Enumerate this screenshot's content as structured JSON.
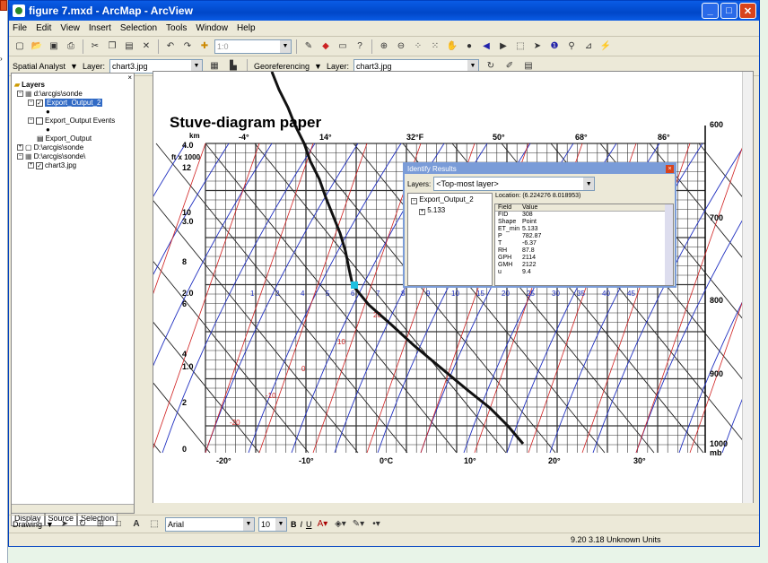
{
  "window": {
    "title": "figure 7.mxd - ArcMap - ArcView"
  },
  "menu": [
    "File",
    "Edit",
    "View",
    "Insert",
    "Selection",
    "Tools",
    "Window",
    "Help"
  ],
  "toolbar": {
    "scale_value": "1:0",
    "spatial_analyst": "Spatial Analyst",
    "layer_label": "Layer:",
    "layer_value": "chart3.jpg",
    "georef": "Georeferencing",
    "layer2_value": "chart3.jpg"
  },
  "toc": {
    "items": [
      {
        "label": "Layers",
        "indent": 0
      },
      {
        "label": "d:\\arcgis\\sonde",
        "indent": 1
      },
      {
        "label": "Export_Output_2",
        "indent": 2,
        "selected": true
      },
      {
        "label": "Export_Output Events",
        "indent": 2
      },
      {
        "label": "Export_Output",
        "indent": 2
      },
      {
        "label": "D:\\arcgis\\sonde",
        "indent": 1
      },
      {
        "label": "D:\\arcgis\\sonde\\",
        "indent": 1
      },
      {
        "label": "chart3.jpg",
        "indent": 2
      }
    ],
    "tabs": [
      "Display",
      "Source",
      "Selection"
    ]
  },
  "map": {
    "title": "Stuve-diagram paper",
    "left_km_label": "km",
    "left_ft_label": "ft x 1000",
    "left_ticks": [
      "4.0",
      "12",
      "10",
      "3.0",
      "8",
      "2.0",
      "6",
      "4",
      "1.0",
      "2",
      "0"
    ],
    "top_temps": [
      "-4°",
      "14°",
      "32°F",
      "50°",
      "68°",
      "86°"
    ],
    "bottom_temps": [
      "-20°",
      "-10°",
      "0°C",
      "10°",
      "20°",
      "30°"
    ],
    "right_pressure": [
      "600",
      "700",
      "800",
      "900",
      "1000",
      "mb"
    ],
    "mixing_labels": [
      "1",
      "2",
      "4",
      "5",
      "6",
      "7",
      "8",
      "9",
      "10",
      "15",
      "20",
      "25",
      "30",
      "35",
      "40",
      "45"
    ],
    "red_labels": [
      "20",
      "10",
      "0",
      "-10",
      "-20"
    ]
  },
  "identify": {
    "title": "Identify Results",
    "layers_label": "Layers:",
    "layers_value": "<Top-most layer>",
    "tree_root": "Export_Output_2",
    "tree_child": "5.133",
    "location": "Location: (6.224276 8.018953)",
    "columns": [
      "Field",
      "Value"
    ],
    "rows": [
      [
        "FID",
        "308"
      ],
      [
        "Shape",
        "Point"
      ],
      [
        "ET_min",
        "5.133"
      ],
      [
        "P",
        "782.87"
      ],
      [
        "T",
        "-6.37"
      ],
      [
        "RH",
        "87.8"
      ],
      [
        "GPH",
        "2114"
      ],
      [
        "GMH",
        "2122"
      ],
      [
        "u",
        "9.4"
      ]
    ]
  },
  "drawing": {
    "label": "Drawing",
    "font": "Arial",
    "size": "10",
    "b": "B",
    "i": "I",
    "u": "U"
  },
  "status": {
    "coords": "9.20  3.18 Unknown Units"
  }
}
